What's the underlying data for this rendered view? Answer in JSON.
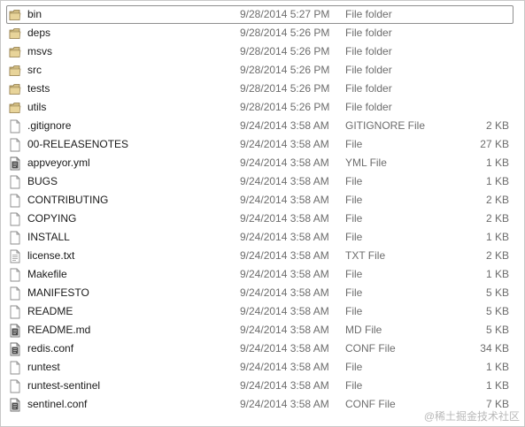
{
  "files": [
    {
      "name": "bin",
      "date": "9/28/2014 5:27 PM",
      "type": "File folder",
      "size": "",
      "icon": "folder-icon",
      "selected": true
    },
    {
      "name": "deps",
      "date": "9/28/2014 5:26 PM",
      "type": "File folder",
      "size": "",
      "icon": "folder-icon"
    },
    {
      "name": "msvs",
      "date": "9/28/2014 5:26 PM",
      "type": "File folder",
      "size": "",
      "icon": "folder-icon"
    },
    {
      "name": "src",
      "date": "9/28/2014 5:26 PM",
      "type": "File folder",
      "size": "",
      "icon": "folder-icon"
    },
    {
      "name": "tests",
      "date": "9/28/2014 5:26 PM",
      "type": "File folder",
      "size": "",
      "icon": "folder-icon"
    },
    {
      "name": "utils",
      "date": "9/28/2014 5:26 PM",
      "type": "File folder",
      "size": "",
      "icon": "folder-icon"
    },
    {
      "name": ".gitignore",
      "date": "9/24/2014 3:58 AM",
      "type": "GITIGNORE File",
      "size": "2 KB",
      "icon": "file-icon"
    },
    {
      "name": "00-RELEASENOTES",
      "date": "9/24/2014 3:58 AM",
      "type": "File",
      "size": "27 KB",
      "icon": "file-icon"
    },
    {
      "name": "appveyor.yml",
      "date": "9/24/2014 3:58 AM",
      "type": "YML File",
      "size": "1 KB",
      "icon": "config-file-icon"
    },
    {
      "name": "BUGS",
      "date": "9/24/2014 3:58 AM",
      "type": "File",
      "size": "1 KB",
      "icon": "file-icon"
    },
    {
      "name": "CONTRIBUTING",
      "date": "9/24/2014 3:58 AM",
      "type": "File",
      "size": "2 KB",
      "icon": "file-icon"
    },
    {
      "name": "COPYING",
      "date": "9/24/2014 3:58 AM",
      "type": "File",
      "size": "2 KB",
      "icon": "file-icon"
    },
    {
      "name": "INSTALL",
      "date": "9/24/2014 3:58 AM",
      "type": "File",
      "size": "1 KB",
      "icon": "file-icon"
    },
    {
      "name": "license.txt",
      "date": "9/24/2014 3:58 AM",
      "type": "TXT File",
      "size": "2 KB",
      "icon": "text-file-icon"
    },
    {
      "name": "Makefile",
      "date": "9/24/2014 3:58 AM",
      "type": "File",
      "size": "1 KB",
      "icon": "file-icon"
    },
    {
      "name": "MANIFESTO",
      "date": "9/24/2014 3:58 AM",
      "type": "File",
      "size": "5 KB",
      "icon": "file-icon"
    },
    {
      "name": "README",
      "date": "9/24/2014 3:58 AM",
      "type": "File",
      "size": "5 KB",
      "icon": "file-icon"
    },
    {
      "name": "README.md",
      "date": "9/24/2014 3:58 AM",
      "type": "MD File",
      "size": "5 KB",
      "icon": "config-file-icon"
    },
    {
      "name": "redis.conf",
      "date": "9/24/2014 3:58 AM",
      "type": "CONF File",
      "size": "34 KB",
      "icon": "config-file-icon"
    },
    {
      "name": "runtest",
      "date": "9/24/2014 3:58 AM",
      "type": "File",
      "size": "1 KB",
      "icon": "file-icon"
    },
    {
      "name": "runtest-sentinel",
      "date": "9/24/2014 3:58 AM",
      "type": "File",
      "size": "1 KB",
      "icon": "file-icon"
    },
    {
      "name": "sentinel.conf",
      "date": "9/24/2014 3:58 AM",
      "type": "CONF File",
      "size": "7 KB",
      "icon": "config-file-icon"
    }
  ],
  "watermark": "@稀土掘金技术社区"
}
